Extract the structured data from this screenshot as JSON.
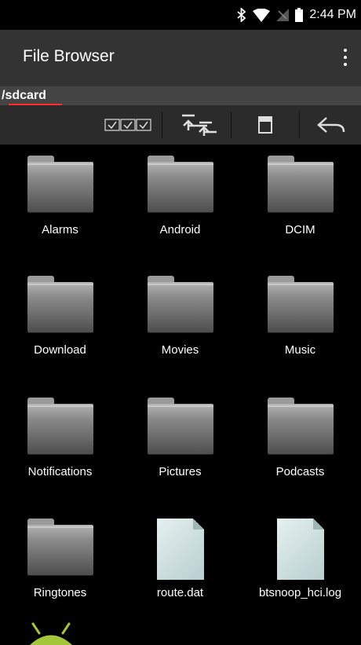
{
  "status_bar": {
    "time": "2:44 PM",
    "icons": [
      "bluetooth-icon",
      "wifi-icon",
      "no-signal-icon",
      "battery-icon"
    ]
  },
  "app_bar": {
    "title": "File Browser",
    "menu_icon": "overflow-menu-icon"
  },
  "path": {
    "current": "/sdcard"
  },
  "toolbar": {
    "buttons": [
      "multi-select-icon",
      "up-directory-icon",
      "save-icon",
      "back-icon"
    ]
  },
  "items": [
    {
      "name": "Alarms",
      "type": "folder"
    },
    {
      "name": "Android",
      "type": "folder"
    },
    {
      "name": "DCIM",
      "type": "folder"
    },
    {
      "name": "Download",
      "type": "folder"
    },
    {
      "name": "Movies",
      "type": "folder"
    },
    {
      "name": "Music",
      "type": "folder"
    },
    {
      "name": "Notifications",
      "type": "folder"
    },
    {
      "name": "Pictures",
      "type": "folder"
    },
    {
      "name": "Podcasts",
      "type": "folder"
    },
    {
      "name": "Ringtones",
      "type": "folder"
    },
    {
      "name": "route.dat",
      "type": "file"
    },
    {
      "name": "btsnoop_hci.log",
      "type": "file"
    }
  ],
  "colors": {
    "app_bar": "#333333",
    "path_bar": "#444444",
    "toolbar": "#2b2b2b",
    "path_underline": "#ff2b2b",
    "android_green": "#a4c639"
  }
}
